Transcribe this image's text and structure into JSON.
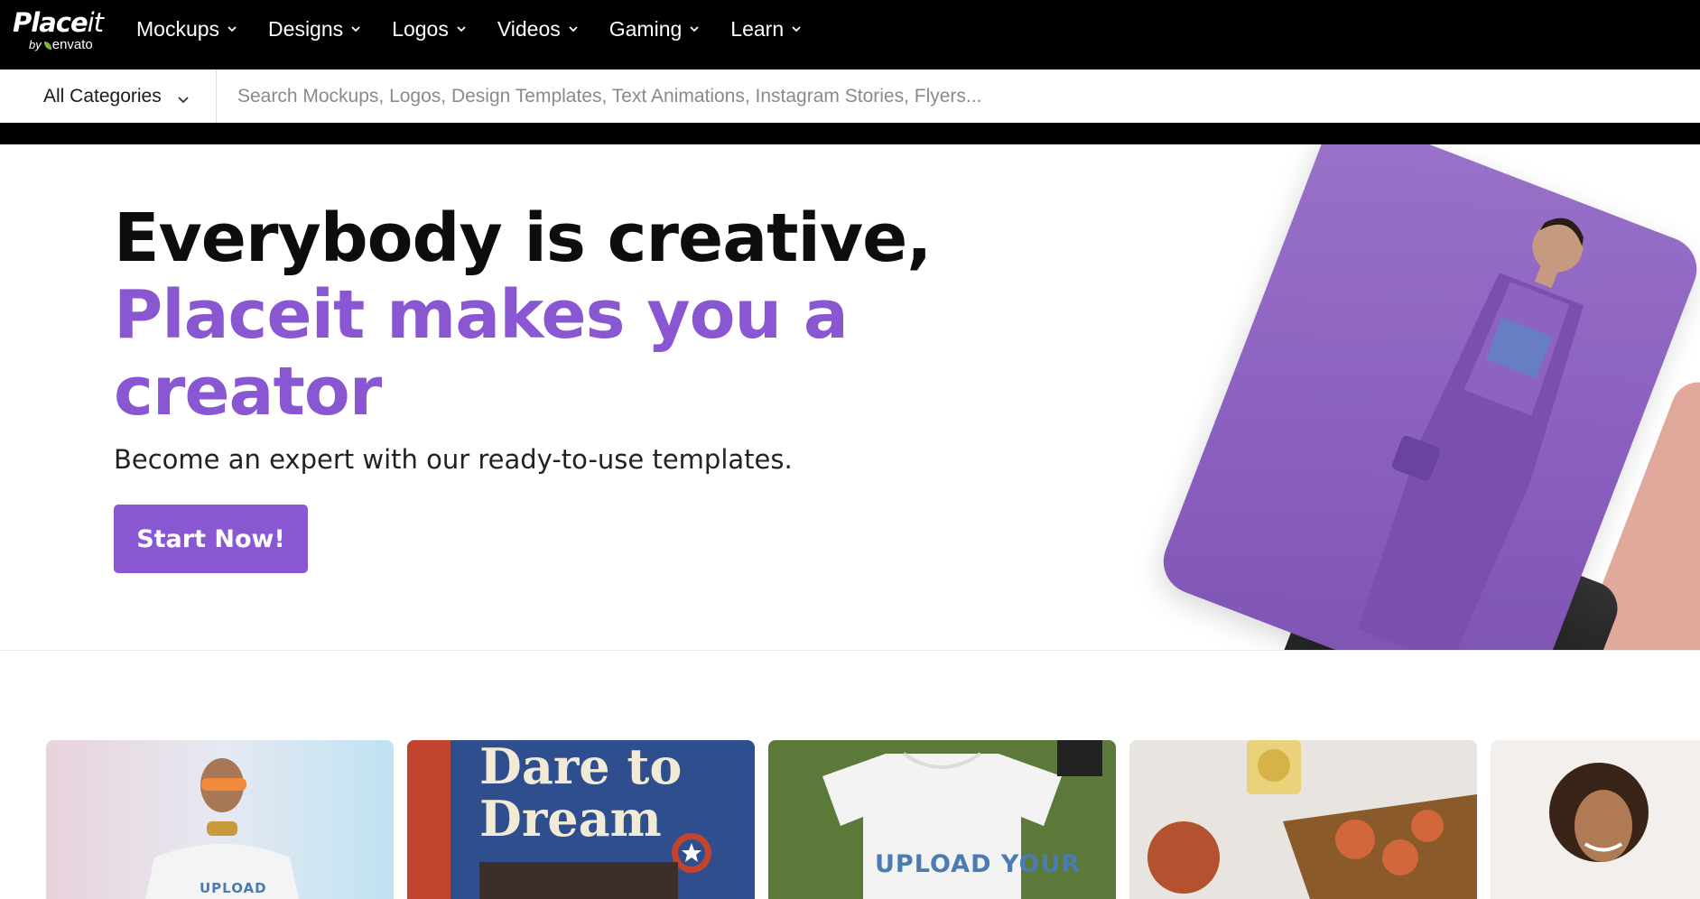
{
  "brand": {
    "logo_main": "Place",
    "logo_it": "it",
    "logo_by": "by",
    "logo_sub": "envato"
  },
  "nav": {
    "items": [
      {
        "label": "Mockups"
      },
      {
        "label": "Designs"
      },
      {
        "label": "Logos"
      },
      {
        "label": "Videos"
      },
      {
        "label": "Gaming"
      },
      {
        "label": "Learn"
      }
    ]
  },
  "search": {
    "category_label": "All Categories",
    "placeholder": "Search Mockups, Logos, Design Templates, Text Animations, Instagram Stories, Flyers..."
  },
  "hero": {
    "title_line1": "Everybody is creative,",
    "title_line2": "Placeit makes you a creator",
    "subtitle": "Become an expert with our ready-to-use templates.",
    "cta_label": "Start Now!",
    "accent_color": "#8957d2"
  },
  "cards": {
    "card2_text": "Dare to Dream",
    "card1_upload": "UPLOAD",
    "card3_upload": "UPLOAD YOUR"
  }
}
